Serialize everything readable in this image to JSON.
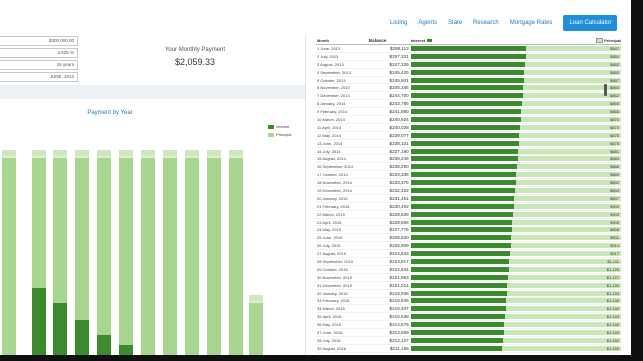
{
  "nav": {
    "links": [
      "Listing",
      "Agents",
      "State",
      "Research",
      "Mortgage Rates"
    ],
    "cta": "Loan Calculator"
  },
  "inputs": [
    "$300,000.00",
    "3.625 %",
    "15 years",
    "JUNE, 2013"
  ],
  "monthly_payment": {
    "label": "Your Monthly Payment",
    "value": "$2,059.33"
  },
  "chart": {
    "title": "Payment by Year",
    "legend": [
      "Interest",
      "Principal"
    ],
    "colors": {
      "interest": "#3c8a2e",
      "principal": "#a8d690",
      "light": "#dcefd0"
    }
  },
  "table": {
    "headers": {
      "month": "Month",
      "balance": "Balance",
      "interest": "Interest",
      "principal": "Principal"
    },
    "rows": [
      {
        "month": "1 June, 2013",
        "balance": "$298,113",
        "interest": "",
        "principal": "$847"
      },
      {
        "month": "2 July, 2013",
        "balance": "$297,321",
        "interest": "",
        "principal": "$850"
      },
      {
        "month": "3 August, 2013",
        "balance": "$247,325",
        "interest": "",
        "principal": "$852"
      },
      {
        "month": "4 September, 2013",
        "balance": "$245,425",
        "interest": "",
        "principal": "$855"
      },
      {
        "month": "5 October, 2013",
        "balance": "$245,501",
        "interest": "",
        "principal": "$857"
      },
      {
        "month": "6 November, 2013",
        "balance": "$245,345",
        "interest": "",
        "principal": "$860"
      },
      {
        "month": "7 December, 2013",
        "balance": "$244,700",
        "interest": "",
        "principal": "$862"
      },
      {
        "month": "8 January, 2014",
        "balance": "$243,785",
        "interest": "",
        "principal": "$865"
      },
      {
        "month": "9 February, 2014",
        "balance": "$241,880",
        "interest": "",
        "principal": "$868"
      },
      {
        "month": "10 March, 2014",
        "balance": "$240,924",
        "interest": "",
        "principal": "$870"
      },
      {
        "month": "11 April, 2014",
        "balance": "$240,028",
        "interest": "",
        "principal": "$873"
      },
      {
        "month": "12 May, 2014",
        "balance": "$239,077",
        "interest": "",
        "principal": "$876"
      },
      {
        "month": "13 June, 2014",
        "balance": "$238,101",
        "interest": "",
        "principal": "$878"
      },
      {
        "month": "14 July, 2014",
        "balance": "$237,190",
        "interest": "",
        "principal": "$881"
      },
      {
        "month": "15 August, 2014",
        "balance": "$236,246",
        "interest": "",
        "principal": "$884"
      },
      {
        "month": "16 September, 2014",
        "balance": "$235,290",
        "interest": "",
        "principal": "$886"
      },
      {
        "month": "17 October, 2014",
        "balance": "$234,336",
        "interest": "",
        "principal": "$889"
      },
      {
        "month": "18 November, 2014",
        "balance": "$233,375",
        "interest": "",
        "principal": "$892"
      },
      {
        "month": "19 December, 2014",
        "balance": "$232,422",
        "interest": "",
        "principal": "$894"
      },
      {
        "month": "20 January, 2015",
        "balance": "$231,451",
        "interest": "",
        "principal": "$897"
      },
      {
        "month": "21 February, 2015",
        "balance": "$230,492",
        "interest": "",
        "principal": "$900"
      },
      {
        "month": "22 March, 2015",
        "balance": "$229,539",
        "interest": "",
        "principal": "$903"
      },
      {
        "month": "23 April, 2015",
        "balance": "$229,656",
        "interest": "",
        "principal": "$905"
      },
      {
        "month": "24 May, 2015",
        "balance": "$227,775",
        "interest": "",
        "principal": "$908"
      },
      {
        "month": "25 June, 2015",
        "balance": "$226,820",
        "interest": "",
        "principal": "$911"
      },
      {
        "month": "26 July, 2015",
        "balance": "$225,909",
        "interest": "",
        "principal": "$914"
      },
      {
        "month": "27 August, 2015",
        "balance": "$224,933",
        "interest": "",
        "principal": "$917"
      },
      {
        "month": "28 September, 2015",
        "balance": "$223,817",
        "interest": "",
        "principal": "$1,111"
      },
      {
        "month": "29 October, 2015",
        "balance": "$222,944",
        "interest": "",
        "principal": "$1,125"
      },
      {
        "month": "30 November, 2015",
        "balance": "$221,963",
        "interest": "",
        "principal": "$1,127"
      },
      {
        "month": "31 December, 2015",
        "balance": "$221,014",
        "interest": "",
        "principal": "$1,130"
      },
      {
        "month": "32 January, 2016",
        "balance": "$219,936",
        "interest": "",
        "principal": "$1,133"
      },
      {
        "month": "33 February, 2016",
        "balance": "$218,945",
        "interest": "",
        "principal": "$1,136"
      },
      {
        "month": "34 March, 2016",
        "balance": "$216,407",
        "interest": "",
        "principal": "$1,140"
      },
      {
        "month": "35 April, 2016",
        "balance": "$215,538",
        "interest": "",
        "principal": "$1,143"
      },
      {
        "month": "36 May, 2016",
        "balance": "$214,575",
        "interest": "",
        "principal": "$1,146"
      },
      {
        "month": "37 June, 2016",
        "balance": "$213,659",
        "interest": "",
        "principal": "$1,149"
      },
      {
        "month": "38 July, 2016",
        "balance": "$212,127",
        "interest": "",
        "principal": "$1,152"
      },
      {
        "month": "39 August, 2016",
        "balance": "$211,155",
        "interest": "",
        "principal": "$1,155"
      }
    ]
  }
}
